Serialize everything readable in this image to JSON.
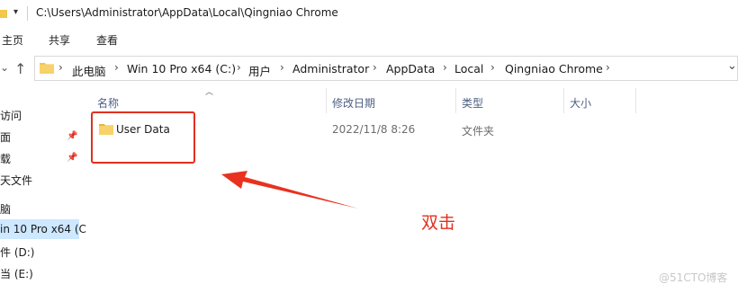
{
  "window": {
    "title_path": "C:\\Users\\Administrator\\AppData\\Local\\Qingniao Chrome",
    "quick_access_dropdown": "▾"
  },
  "ribbon": {
    "tabs": [
      "主页",
      "共享",
      "查看"
    ]
  },
  "address": {
    "crumbs": [
      "此电脑",
      "Win 10 Pro x64 (C:)",
      "用户",
      "Administrator",
      "AppData",
      "Local",
      "Qingniao Chrome"
    ]
  },
  "nav_pane": {
    "items": [
      "访问",
      "面",
      "载",
      "天文件",
      "脑",
      "in 10 Pro x64 (C",
      "件 (D:)",
      "当 (E:)"
    ]
  },
  "columns": {
    "name": "名称",
    "date": "修改日期",
    "type": "类型",
    "size": "大小"
  },
  "files": [
    {
      "name": "User Data",
      "date": "2022/11/8 8:26",
      "type": "文件夹",
      "size": ""
    }
  ],
  "annotation": {
    "text": "双击",
    "color": "#e0301e"
  },
  "watermark": "@51CTO博客"
}
